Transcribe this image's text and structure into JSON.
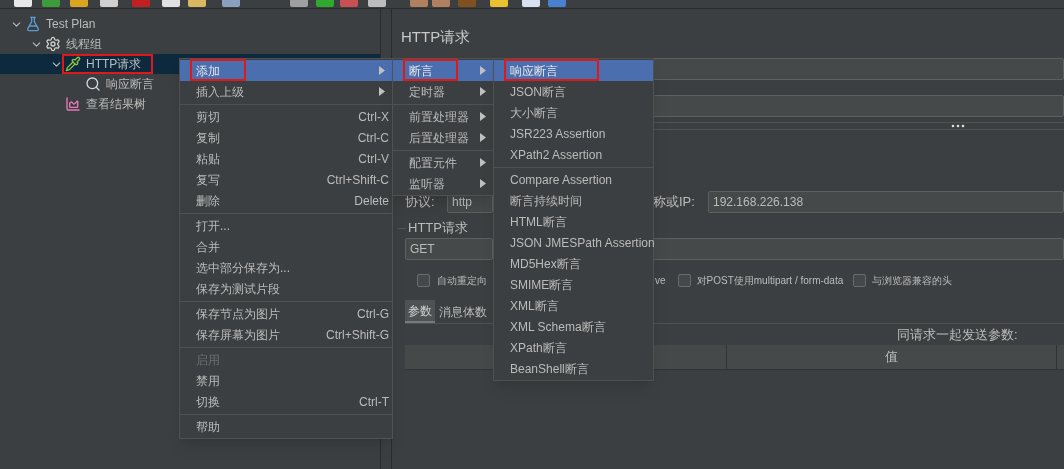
{
  "tree": [
    {
      "label": "Test Plan",
      "kind": "plan",
      "expanded": true,
      "selected": false,
      "marked": false,
      "children": [
        {
          "label": "线程组",
          "kind": "thread_group",
          "expanded": true,
          "selected": false,
          "marked": false,
          "children": [
            {
              "label": "HTTP请求",
              "kind": "sampler",
              "expanded": true,
              "selected": true,
              "marked": true,
              "children": [
                {
                  "label": "响应断言",
                  "kind": "assertion",
                  "selected": false,
                  "marked": false
                }
              ]
            },
            {
              "label": "查看结果树",
              "kind": "listener",
              "selected": false,
              "marked": false
            }
          ]
        }
      ]
    }
  ],
  "context_menu": [
    {
      "kind": "item",
      "label": "添加",
      "submenu": true,
      "selected": true,
      "marked": true,
      "disabled": false
    },
    {
      "kind": "item",
      "label": "插入上级",
      "submenu": true,
      "selected": false,
      "marked": false,
      "disabled": false
    },
    {
      "kind": "separator"
    },
    {
      "kind": "item",
      "label": "剪切",
      "shortcut": "Ctrl-X",
      "selected": false,
      "marked": false,
      "disabled": false
    },
    {
      "kind": "item",
      "label": "复制",
      "shortcut": "Ctrl-C",
      "selected": false,
      "marked": false,
      "disabled": false
    },
    {
      "kind": "item",
      "label": "粘贴",
      "shortcut": "Ctrl-V",
      "selected": false,
      "marked": false,
      "disabled": false
    },
    {
      "kind": "item",
      "label": "复写",
      "shortcut": "Ctrl+Shift-C",
      "selected": false,
      "marked": false,
      "disabled": false
    },
    {
      "kind": "item",
      "label": "删除",
      "shortcut": "Delete",
      "selected": false,
      "marked": false,
      "disabled": false
    },
    {
      "kind": "separator"
    },
    {
      "kind": "item",
      "label": "打开...",
      "selected": false,
      "marked": false,
      "disabled": false
    },
    {
      "kind": "item",
      "label": "合并",
      "selected": false,
      "marked": false,
      "disabled": false
    },
    {
      "kind": "item",
      "label": "选中部分保存为...",
      "selected": false,
      "marked": false,
      "disabled": false
    },
    {
      "kind": "item",
      "label": "保存为测试片段",
      "selected": false,
      "marked": false,
      "disabled": false
    },
    {
      "kind": "separator"
    },
    {
      "kind": "item",
      "label": "保存节点为图片",
      "shortcut": "Ctrl-G",
      "selected": false,
      "marked": false,
      "disabled": false
    },
    {
      "kind": "item",
      "label": "保存屏幕为图片",
      "shortcut": "Ctrl+Shift-G",
      "selected": false,
      "marked": false,
      "disabled": false
    },
    {
      "kind": "separator"
    },
    {
      "kind": "item",
      "label": "启用",
      "selected": false,
      "marked": false,
      "disabled": true
    },
    {
      "kind": "item",
      "label": "禁用",
      "selected": false,
      "marked": false,
      "disabled": false
    },
    {
      "kind": "item",
      "label": "切换",
      "shortcut": "Ctrl-T",
      "selected": false,
      "marked": false,
      "disabled": false
    },
    {
      "kind": "separator"
    },
    {
      "kind": "item",
      "label": "帮助",
      "selected": false,
      "marked": false,
      "disabled": false
    }
  ],
  "add_submenu": [
    {
      "kind": "item",
      "label": "断言",
      "submenu": true,
      "selected": true,
      "marked": true,
      "disabled": false
    },
    {
      "kind": "item",
      "label": "定时器",
      "submenu": true,
      "selected": false,
      "marked": false,
      "disabled": false
    },
    {
      "kind": "separator"
    },
    {
      "kind": "item",
      "label": "前置处理器",
      "submenu": true,
      "selected": false,
      "marked": false,
      "disabled": false
    },
    {
      "kind": "item",
      "label": "后置处理器",
      "submenu": true,
      "selected": false,
      "marked": false,
      "disabled": false
    },
    {
      "kind": "separator"
    },
    {
      "kind": "item",
      "label": "配置元件",
      "submenu": true,
      "selected": false,
      "marked": false,
      "disabled": false
    },
    {
      "kind": "item",
      "label": "监听器",
      "submenu": true,
      "selected": false,
      "marked": false,
      "disabled": false
    }
  ],
  "assertion_submenu": [
    {
      "kind": "item",
      "label": "响应断言",
      "selected": true,
      "marked": true,
      "disabled": false
    },
    {
      "kind": "item",
      "label": "JSON断言",
      "selected": false,
      "marked": false,
      "disabled": false
    },
    {
      "kind": "item",
      "label": "大小断言",
      "selected": false,
      "marked": false,
      "disabled": false
    },
    {
      "kind": "item",
      "label": "JSR223 Assertion",
      "selected": false,
      "marked": false,
      "disabled": false
    },
    {
      "kind": "item",
      "label": "XPath2 Assertion",
      "selected": false,
      "marked": false,
      "disabled": false
    },
    {
      "kind": "separator"
    },
    {
      "kind": "item",
      "label": "Compare Assertion",
      "selected": false,
      "marked": false,
      "disabled": false
    },
    {
      "kind": "item",
      "label": "断言持续时间",
      "selected": false,
      "marked": false,
      "disabled": false
    },
    {
      "kind": "item",
      "label": "HTML断言",
      "selected": false,
      "marked": false,
      "disabled": false
    },
    {
      "kind": "item",
      "label": "JSON JMESPath Assertion",
      "selected": false,
      "marked": false,
      "disabled": false
    },
    {
      "kind": "item",
      "label": "MD5Hex断言",
      "selected": false,
      "marked": false,
      "disabled": false
    },
    {
      "kind": "item",
      "label": "SMIME断言",
      "selected": false,
      "marked": false,
      "disabled": false
    },
    {
      "kind": "item",
      "label": "XML断言",
      "selected": false,
      "marked": false,
      "disabled": false
    },
    {
      "kind": "item",
      "label": "XML Schema断言",
      "selected": false,
      "marked": false,
      "disabled": false
    },
    {
      "kind": "item",
      "label": "XPath断言",
      "selected": false,
      "marked": false,
      "disabled": false
    },
    {
      "kind": "item",
      "label": "BeanShell断言",
      "selected": false,
      "marked": false,
      "disabled": false
    }
  ],
  "editor": {
    "title": "HTTP请求",
    "protocol_label": "协议:",
    "protocol_value": "http",
    "server_label": "称或IP:",
    "server_value": "192.168.226.138",
    "group_label": "HTTP请求",
    "method_value": "GET",
    "option_fragment": "ve",
    "options": [
      {
        "label": "自动重定向",
        "checked": false
      },
      {
        "label": "对POST使用multipart / form-data",
        "checked": false
      },
      {
        "label": "与浏览器兼容的头",
        "checked": false
      }
    ],
    "tabs": [
      {
        "label": "参数",
        "selected": true
      },
      {
        "label": "消息体数",
        "selected": false
      }
    ],
    "params_caption": "同请求一起发送参数:",
    "table": {
      "columns": [
        "值"
      ]
    }
  }
}
